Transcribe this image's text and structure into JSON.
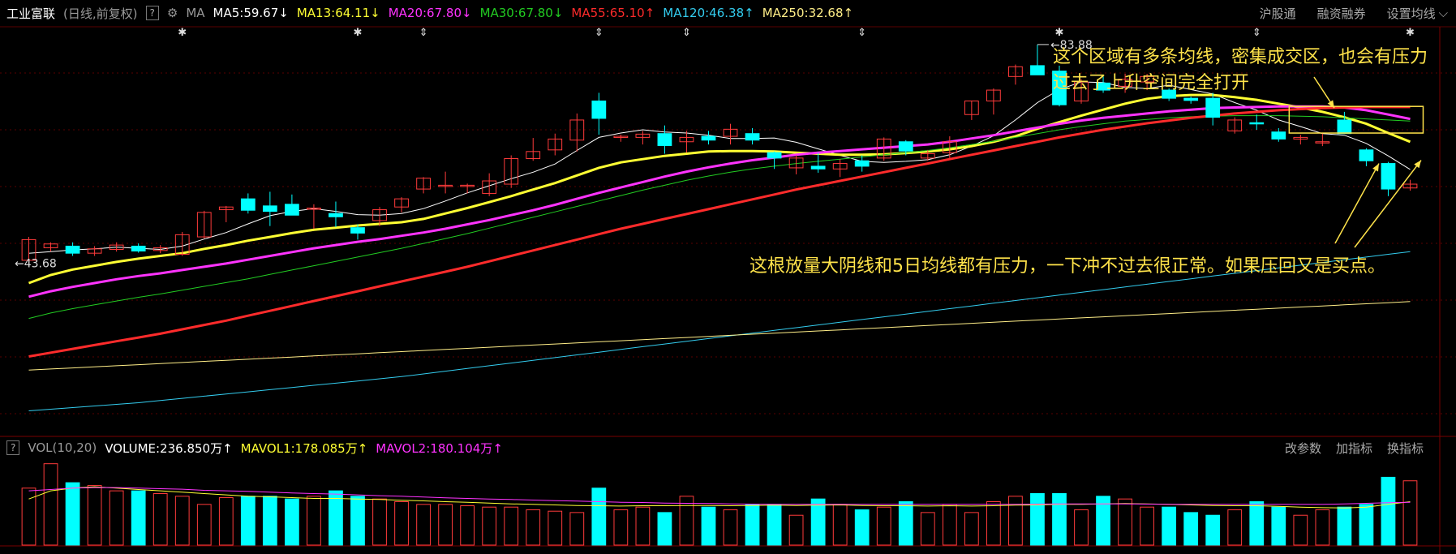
{
  "header": {
    "symbol": "工业富联",
    "period": "(日线,前复权)",
    "help": "?",
    "ma_label": "MA",
    "ma_items": [
      {
        "text": "MA5:59.67",
        "arrow": "↓",
        "color": "#ffffff"
      },
      {
        "text": "MA13:64.11",
        "arrow": "↓",
        "color": "#ffff33"
      },
      {
        "text": "MA20:67.80",
        "arrow": "↓",
        "color": "#ff33ff"
      },
      {
        "text": "MA30:67.80",
        "arrow": "↓",
        "color": "#22cc22"
      },
      {
        "text": "MA55:65.10",
        "arrow": "↑",
        "color": "#ff2b2b"
      },
      {
        "text": "MA120:46.38",
        "arrow": "↑",
        "color": "#33ccee"
      },
      {
        "text": "MA250:32.68",
        "arrow": "↑",
        "color": "#ffee88"
      }
    ],
    "links": [
      "沪股通",
      "融资融券",
      "设置均线"
    ]
  },
  "volume_header": {
    "help": "?",
    "vol_label": "VOL(10,20)",
    "volume": "VOLUME:236.850万",
    "volume_arrow": "↑",
    "mavol1": "MAVOL1:178.085万",
    "mavol1_arrow": "↑",
    "mavol2": "MAVOL2:180.104万",
    "mavol2_arrow": "↑",
    "links": [
      "改参数",
      "加指标",
      "换指标"
    ]
  },
  "annotations": {
    "zone_line1": "这个区域有多条均线，密集成交区，也会有压力",
    "zone_line2": "过去了上升空间完全打开",
    "bottom_note": "这根放量大阴线和5日均线都有压力，一下冲不过去很正常。如果压回又是买点。"
  },
  "colors": {
    "up": "#ff3b3b",
    "down": "#00ffff",
    "background": "#000000",
    "grid": "#5a0000",
    "annotation": "#ffe34a"
  },
  "chart_data": [
    {
      "type": "candlestick",
      "title": "工业富联 (日线,前复权)",
      "high_marker": "83.88",
      "low_marker": "43.68",
      "x": [
        1,
        2,
        3,
        4,
        5,
        6,
        7,
        8,
        9,
        10,
        11,
        12,
        13,
        14,
        15,
        16,
        17,
        18,
        19,
        20,
        21,
        22,
        23,
        24,
        25,
        26,
        27,
        28,
        29,
        30,
        31,
        32,
        33,
        34,
        35,
        36,
        37,
        38,
        39,
        40,
        41,
        42,
        43,
        44,
        45,
        46,
        47,
        48,
        49,
        50,
        51,
        52,
        53,
        54,
        55,
        56,
        57,
        58,
        59,
        60,
        61,
        62,
        63,
        64
      ],
      "ohlc": [
        [
          44.2,
          48.5,
          43.68,
          48.0
        ],
        [
          46.5,
          47.5,
          45.8,
          47.2
        ],
        [
          46.8,
          47.5,
          45.0,
          45.5
        ],
        [
          45.5,
          46.8,
          45.0,
          46.3
        ],
        [
          46.2,
          47.5,
          45.8,
          47.0
        ],
        [
          46.8,
          47.3,
          45.6,
          45.9
        ],
        [
          46.0,
          47.0,
          45.5,
          46.5
        ],
        [
          45.3,
          49.4,
          45.0,
          48.9
        ],
        [
          48.5,
          53.3,
          48.2,
          53.0
        ],
        [
          53.5,
          54.2,
          51.2,
          54.0
        ],
        [
          55.5,
          56.5,
          52.8,
          53.4
        ],
        [
          54.2,
          56.8,
          50.5,
          53.2
        ],
        [
          54.5,
          56.3,
          52.9,
          52.5
        ],
        [
          53.8,
          54.5,
          50.0,
          53.8
        ],
        [
          52.8,
          55.0,
          50.3,
          52.2
        ],
        [
          50.2,
          50.8,
          48.0,
          49.2
        ],
        [
          51.5,
          54.0,
          50.5,
          53.5
        ],
        [
          54.0,
          55.8,
          53.0,
          55.5
        ],
        [
          57.3,
          59.5,
          56.5,
          59.3
        ],
        [
          58.0,
          60.5,
          56.5,
          58.0
        ],
        [
          58.0,
          58.3,
          56.5,
          58.0
        ],
        [
          56.5,
          60.2,
          56.0,
          58.8
        ],
        [
          58.2,
          63.5,
          57.5,
          62.9
        ],
        [
          62.9,
          66.7,
          62.5,
          64.2
        ],
        [
          64.5,
          67.5,
          63.5,
          66.5
        ],
        [
          66.3,
          71.2,
          64.2,
          70.0
        ],
        [
          73.5,
          75.0,
          67.3,
          70.3
        ],
        [
          67.0,
          67.3,
          66.0,
          67.0
        ],
        [
          66.8,
          68.0,
          65.5,
          67.4
        ],
        [
          67.5,
          69.0,
          63.8,
          65.3
        ],
        [
          66.0,
          68.0,
          64.0,
          66.8
        ],
        [
          67.0,
          68.0,
          65.5,
          66.3
        ],
        [
          67.0,
          69.3,
          65.5,
          68.3
        ],
        [
          67.5,
          68.5,
          65.5,
          66.3
        ],
        [
          64.0,
          64.2,
          61.0,
          63.0
        ],
        [
          61.2,
          63.5,
          60.0,
          63.0
        ],
        [
          61.5,
          64.0,
          60.3,
          61.0
        ],
        [
          61.0,
          62.8,
          59.5,
          62.0
        ],
        [
          62.5,
          63.5,
          60.5,
          61.5
        ],
        [
          63.0,
          66.8,
          62.5,
          66.5
        ],
        [
          66.0,
          66.3,
          63.5,
          64.3
        ],
        [
          63.0,
          64.5,
          62.5,
          63.8
        ],
        [
          64.0,
          67.0,
          63.0,
          66.0
        ],
        [
          71.0,
          73.5,
          70.0,
          73.5
        ],
        [
          73.5,
          75.8,
          71.0,
          75.5
        ],
        [
          78.0,
          80.2,
          76.5,
          79.8
        ],
        [
          80.0,
          83.88,
          78.8,
          78.3
        ],
        [
          79.0,
          80.0,
          72.5,
          72.8
        ],
        [
          73.5,
          77.5,
          73.0,
          77.0
        ],
        [
          76.8,
          78.0,
          75.0,
          75.5
        ],
        [
          76.2,
          78.5,
          75.0,
          77.5
        ],
        [
          77.0,
          78.5,
          75.5,
          78.0
        ],
        [
          75.5,
          75.8,
          73.5,
          74.0
        ],
        [
          74.0,
          74.3,
          73.0,
          73.6
        ],
        [
          74.0,
          75.0,
          69.0,
          70.5
        ],
        [
          68.0,
          70.5,
          67.5,
          70.0
        ],
        [
          69.5,
          71.0,
          68.2,
          69.4
        ],
        [
          67.8,
          68.5,
          66.0,
          66.5
        ],
        [
          66.5,
          67.3,
          65.5,
          66.8
        ],
        [
          66.0,
          67.5,
          65.2,
          66.0
        ],
        [
          70.0,
          71.5,
          67.5,
          67.5
        ],
        [
          64.5,
          64.8,
          61.5,
          62.5
        ],
        [
          62.0,
          62.3,
          56.0,
          57.3
        ],
        [
          57.5,
          59.0,
          57.0,
          58.2
        ]
      ],
      "ma_series": [
        {
          "name": "MA5",
          "values": [
            45.5,
            45.8,
            46.1,
            46.3,
            46.6,
            46.4,
            46.2,
            46.8,
            48.1,
            49.3,
            50.9,
            52.4,
            53.2,
            53.7,
            53.2,
            52.6,
            52.5,
            52.8,
            53.7,
            55.1,
            56.6,
            57.9,
            59.2,
            60.4,
            61.9,
            64.4,
            66.8,
            67.6,
            68.2,
            67.8,
            67.6,
            67.2,
            66.6,
            66.6,
            66.7,
            65.9,
            64.7,
            63.5,
            62.4,
            62.2,
            62.4,
            62.7,
            63.6,
            65.2,
            67.1,
            70.0,
            73.2,
            75.6,
            77.0,
            76.9,
            76.0,
            75.8,
            76.4,
            75.6,
            74.8,
            73.2,
            71.8,
            70.0,
            68.8,
            67.5,
            67.2,
            65.7,
            63.4,
            60.9
          ]
        },
        {
          "name": "MA13",
          "values": [
            40.0,
            41.5,
            42.5,
            43.2,
            43.9,
            44.5,
            45.0,
            45.5,
            46.3,
            47.0,
            47.8,
            48.5,
            49.2,
            49.8,
            50.2,
            50.6,
            50.9,
            51.2,
            51.8,
            52.8,
            53.8,
            54.9,
            56.0,
            57.2,
            58.4,
            59.8,
            61.2,
            62.2,
            62.8,
            63.4,
            63.8,
            64.2,
            64.3,
            64.3,
            64.2,
            64.0,
            63.8,
            63.6,
            63.6,
            63.7,
            63.9,
            64.2,
            64.6,
            65.2,
            66.0,
            67.0,
            68.4,
            69.6,
            70.8,
            71.9,
            73.0,
            73.9,
            74.4,
            74.6,
            74.6,
            74.2,
            73.7,
            73.0,
            72.3,
            71.5,
            70.5,
            69.3,
            67.6,
            66.0
          ]
        },
        {
          "name": "MA20",
          "values": [
            37.5,
            38.5,
            39.3,
            40.0,
            40.7,
            41.3,
            41.8,
            42.4,
            43.0,
            43.6,
            44.3,
            45.0,
            45.7,
            46.4,
            47.0,
            47.6,
            48.1,
            48.7,
            49.3,
            50.0,
            50.8,
            51.6,
            52.5,
            53.4,
            54.4,
            55.5,
            56.6,
            57.6,
            58.6,
            59.6,
            60.5,
            61.3,
            62.0,
            62.6,
            63.1,
            63.6,
            64.0,
            64.3,
            64.6,
            64.9,
            65.2,
            65.5,
            66.0,
            66.6,
            67.2,
            67.9,
            68.6,
            69.3,
            69.9,
            70.4,
            70.8,
            71.2,
            71.6,
            71.9,
            72.2,
            72.3,
            72.4,
            72.5,
            72.5,
            72.5,
            72.3,
            71.8,
            71.0,
            70.2
          ]
        },
        {
          "name": "MA30",
          "values": [
            33.5,
            34.5,
            35.3,
            36.0,
            36.7,
            37.4,
            38.0,
            38.7,
            39.4,
            40.1,
            40.8,
            41.6,
            42.4,
            43.2,
            44.0,
            44.8,
            45.6,
            46.4,
            47.3,
            48.2,
            49.1,
            50.1,
            51.1,
            52.1,
            53.1,
            54.1,
            55.1,
            56.1,
            57.1,
            58.0,
            58.9,
            59.7,
            60.4,
            61.0,
            61.5,
            62.0,
            62.4,
            62.8,
            63.2,
            63.6,
            64.0,
            64.4,
            64.9,
            65.5,
            66.1,
            66.8,
            67.5,
            68.2,
            68.8,
            69.3,
            69.8,
            70.1,
            70.4,
            70.6,
            70.7,
            70.8,
            70.8,
            70.8,
            70.7,
            70.6,
            70.4,
            70.2,
            70.0,
            69.8
          ]
        },
        {
          "name": "MA55",
          "values": [
            26.5,
            27.2,
            27.9,
            28.6,
            29.3,
            30.0,
            30.7,
            31.5,
            32.3,
            33.1,
            34.0,
            34.9,
            35.8,
            36.7,
            37.6,
            38.5,
            39.4,
            40.3,
            41.2,
            42.1,
            43.0,
            44.0,
            45.0,
            46.0,
            47.0,
            48.0,
            49.0,
            50.0,
            50.9,
            51.8,
            52.7,
            53.6,
            54.5,
            55.4,
            56.3,
            57.2,
            58.0,
            58.8,
            59.6,
            60.4,
            61.2,
            62.0,
            62.8,
            63.6,
            64.4,
            65.2,
            66.0,
            66.8,
            67.5,
            68.2,
            68.8,
            69.4,
            69.9,
            70.4,
            70.8,
            71.2,
            71.5,
            71.8,
            72.0,
            72.2,
            72.3,
            72.4,
            72.4,
            72.4
          ]
        },
        {
          "name": "MA120",
          "values": [
            16.5,
            16.8,
            17.1,
            17.4,
            17.7,
            18.0,
            18.4,
            18.8,
            19.2,
            19.6,
            20.0,
            20.4,
            20.8,
            21.2,
            21.6,
            22.0,
            22.4,
            22.8,
            23.3,
            23.8,
            24.3,
            24.8,
            25.3,
            25.8,
            26.3,
            26.8,
            27.3,
            27.8,
            28.3,
            28.8,
            29.3,
            29.8,
            30.3,
            30.8,
            31.3,
            31.8,
            32.3,
            32.8,
            33.3,
            33.8,
            34.3,
            34.8,
            35.3,
            35.8,
            36.3,
            36.8,
            37.3,
            37.8,
            38.3,
            38.8,
            39.3,
            39.8,
            40.3,
            40.8,
            41.3,
            41.8,
            42.3,
            42.8,
            43.3,
            43.8,
            44.3,
            44.8,
            45.3,
            45.8
          ]
        },
        {
          "name": "MA250",
          "values": [
            24.0,
            24.2,
            24.4,
            24.6,
            24.8,
            25.0,
            25.2,
            25.4,
            25.6,
            25.8,
            26.0,
            26.2,
            26.4,
            26.6,
            26.8,
            27.0,
            27.2,
            27.4,
            27.6,
            27.8,
            28.0,
            28.2,
            28.4,
            28.6,
            28.8,
            29.0,
            29.2,
            29.4,
            29.6,
            29.8,
            30.0,
            30.2,
            30.4,
            30.6,
            30.8,
            31.0,
            31.2,
            31.4,
            31.6,
            31.8,
            32.0,
            32.2,
            32.4,
            32.6,
            32.8,
            33.0,
            33.2,
            33.4,
            33.6,
            33.8,
            34.0,
            34.2,
            34.4,
            34.6,
            34.8,
            35.0,
            35.2,
            35.4,
            35.6,
            35.8,
            36.0,
            36.2,
            36.4,
            36.6
          ]
        }
      ],
      "ylim": [
        13,
        87
      ]
    },
    {
      "type": "bar",
      "title": "VOL(10,20)",
      "values": [
        210,
        300,
        230,
        220,
        200,
        200,
        190,
        180,
        150,
        175,
        180,
        180,
        170,
        180,
        200,
        180,
        170,
        160,
        150,
        150,
        145,
        140,
        140,
        130,
        125,
        120,
        210,
        130,
        140,
        120,
        180,
        140,
        130,
        150,
        150,
        110,
        170,
        150,
        130,
        140,
        160,
        120,
        150,
        120,
        160,
        180,
        190,
        190,
        130,
        180,
        170,
        140,
        140,
        120,
        110,
        130,
        160,
        140,
        110,
        130,
        140,
        150,
        250,
        237
      ],
      "mavol1": [
        170,
        200,
        210,
        215,
        210,
        205,
        200,
        195,
        190,
        185,
        180,
        178,
        175,
        172,
        172,
        170,
        168,
        165,
        163,
        160,
        158,
        155,
        152,
        150,
        148,
        146,
        145,
        144,
        145,
        145,
        146,
        146,
        145,
        146,
        147,
        146,
        147,
        148,
        146,
        145,
        145,
        144,
        145,
        144,
        145,
        147,
        148,
        150,
        150,
        152,
        153,
        152,
        150,
        148,
        146,
        145,
        145,
        143,
        140,
        138,
        137,
        140,
        150,
        160
      ],
      "mavol2": [
        200,
        205,
        210,
        212,
        212,
        210,
        208,
        206,
        202,
        200,
        198,
        195,
        192,
        190,
        188,
        185,
        182,
        180,
        177,
        174,
        172,
        170,
        168,
        166,
        164,
        162,
        160,
        158,
        157,
        155,
        154,
        153,
        152,
        151,
        150,
        150,
        150,
        150,
        150,
        150,
        150,
        150,
        150,
        150,
        150,
        150,
        151,
        152,
        152,
        152,
        152,
        151,
        150,
        150,
        150,
        150,
        150,
        150,
        150,
        150,
        152,
        154,
        156,
        158
      ],
      "ylim": [
        0,
        320
      ]
    }
  ]
}
